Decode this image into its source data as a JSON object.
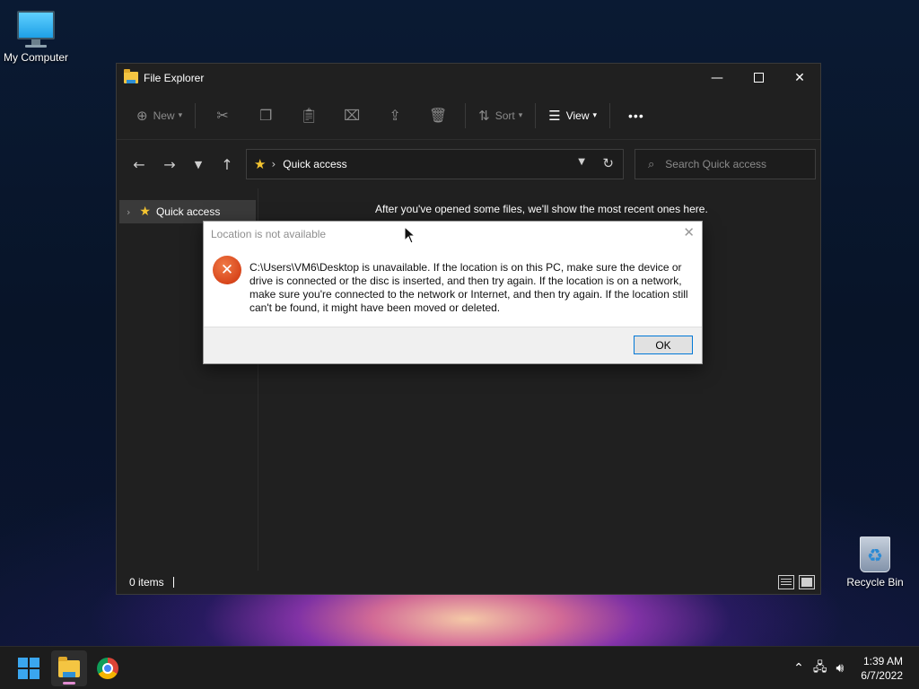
{
  "desktop": {
    "icons": [
      {
        "label": "My Computer",
        "icon": "monitor-icon"
      },
      {
        "label": "Recycle Bin",
        "icon": "recycle-bin-icon"
      }
    ]
  },
  "explorer": {
    "title": "File Explorer",
    "commandbar": {
      "new_label": "New",
      "sort_label": "Sort",
      "view_label": "View",
      "more_glyph": "•••"
    },
    "address": {
      "location": "Quick access"
    },
    "search": {
      "placeholder": "Search Quick access"
    },
    "navpane": {
      "items": [
        {
          "label": "Quick access"
        }
      ]
    },
    "content": {
      "empty_message": "After you've opened some files, we'll show the most recent ones here."
    },
    "status": {
      "item_count": "0 items"
    }
  },
  "dialog": {
    "title": "Location is not available",
    "message": "C:\\Users\\VM6\\Desktop is unavailable. If the location is on this PC, make sure the device or drive is connected or the disc is inserted, and then try again. If the location is on a network, make sure you're connected to the network or Internet, and then try again. If the location still can't be found, it might have been moved or deleted.",
    "ok_label": "OK",
    "icon": "error-icon"
  },
  "taskbar": {
    "time": "1:39 AM",
    "date": "6/7/2022",
    "apps": [
      "start-icon",
      "file-explorer-icon",
      "chrome-icon"
    ],
    "tray": [
      "chevron-up-icon",
      "network-icon",
      "volume-icon"
    ]
  },
  "colors": {
    "accent": "#0078d7",
    "error": "#d8461c",
    "window_bg": "#202020"
  }
}
